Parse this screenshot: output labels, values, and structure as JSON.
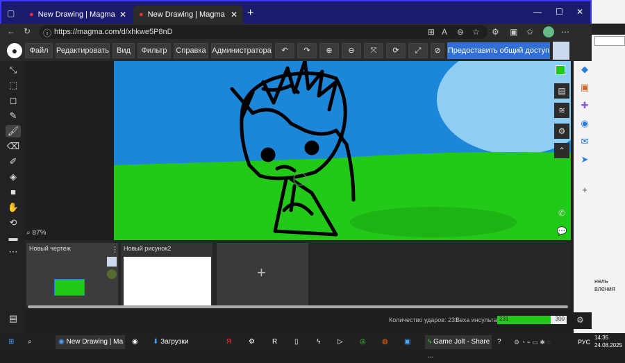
{
  "browser": {
    "tabs": [
      {
        "title": "New Drawing | Magma - The bro",
        "active": false
      },
      {
        "title": "New Drawing | Magma",
        "active": true
      }
    ],
    "new_tab": "+",
    "url": "https://magma.com/d/xhkwe5P8nD",
    "window_controls": {
      "minimize": "—",
      "maximize": "☐",
      "close": "✕"
    }
  },
  "toolbar": {
    "menus": [
      "Файл",
      "Редактировать",
      "Вид",
      "Фильтр",
      "Справка",
      "Администратора"
    ],
    "share_label": "Предоставить общий доступ"
  },
  "canvas": {
    "zoom": "87%",
    "colors": {
      "sky": "#1c86d9",
      "grass": "#22c918",
      "sun": "#90cdf4",
      "stroke": "#000000"
    }
  },
  "drawings": [
    {
      "title": "Новый чертеж"
    },
    {
      "title": "Новый рисунок2"
    }
  ],
  "add_drawing": "+",
  "status": {
    "strokes_label": "Количество ударов: 231",
    "weight_label": "Веха инсульта:",
    "progress_value": "231",
    "progress_max": "300",
    "progress_fraction": 0.77
  },
  "desktop_edge": {
    "texts": [
      "нель",
      "вления"
    ]
  },
  "taskbar": {
    "items": [
      "New Drawing | Ма",
      "Загрузки",
      "Game Jolt - Share ..."
    ],
    "lang": "РУС",
    "time": "14:35",
    "date": "24.08.2025"
  }
}
